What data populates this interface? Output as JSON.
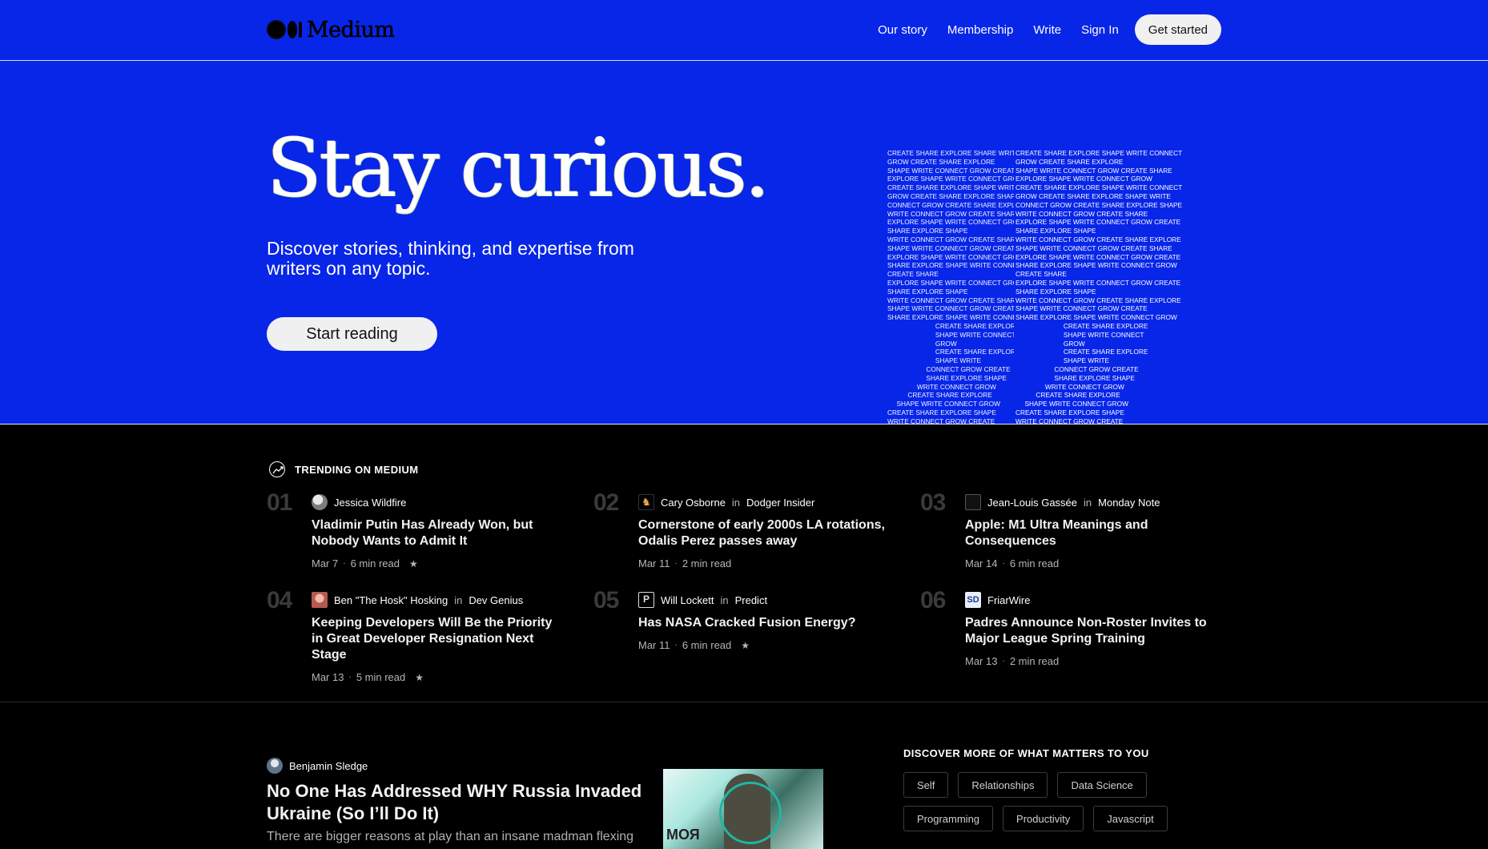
{
  "header": {
    "logo_text": "Medium",
    "nav": [
      "Our story",
      "Membership",
      "Write",
      "Sign In"
    ],
    "cta": "Get started"
  },
  "hero": {
    "title": "Stay curious.",
    "subtitle": "Discover stories, thinking, and expertise from writers on any topic.",
    "button": "Start reading",
    "wordart_left": [
      "CREATE SHARE EXPLORE SHARE WRITE",
      "GROW CREATE SHARE EXPLORE",
      "SHAPE WRITE CONNECT GROW CREATE",
      "EXPLORE SHAPE WRITE CONNECT GROW",
      "CREATE SHARE EXPLORE SHAPE WRITE",
      "GROW CREATE SHARE EXPLORE SHAPE",
      "CONNECT GROW CREATE SHARE EXPLORE",
      "WRITE CONNECT GROW CREATE SHARE",
      "EXPLORE SHAPE WRITE CONNECT GROW",
      "SHARE EXPLORE SHAPE",
      "WRITE CONNECT GROW CREATE SHARE",
      "SHAPE WRITE CONNECT GROW CREATE",
      "EXPLORE SHAPE WRITE CONNECT GROW",
      "SHARE EXPLORE SHAPE WRITE CONNECT",
      "CREATE SHARE",
      "EXPLORE SHAPE WRITE CONNECT GROW",
      "SHARE EXPLORE SHAPE",
      "WRITE CONNECT GROW CREATE SHARE",
      "SHAPE WRITE CONNECT GROW CREATE",
      "SHARE EXPLORE SHAPE WRITE CONNECT",
      "                          CREATE SHARE EXPLORE",
      "                          SHAPE WRITE CONNECT",
      "                          GROW",
      "                          CREATE SHARE EXPLORE",
      "                          SHAPE WRITE",
      "                     CONNECT GROW CREATE",
      "                     SHARE EXPLORE SHAPE",
      "                WRITE CONNECT GROW",
      "           CREATE SHARE EXPLORE",
      "     SHAPE WRITE CONNECT GROW",
      "CREATE SHARE EXPLORE SHAPE",
      "WRITE CONNECT GROW CREATE"
    ],
    "wordart_right": [
      "CREATE SHARE EXPLORE SHAPE WRITE CONNECT",
      "GROW CREATE SHARE EXPLORE",
      "SHAPE WRITE CONNECT GROW CREATE SHARE",
      "EXPLORE SHAPE WRITE CONNECT GROW",
      "CREATE SHARE EXPLORE SHAPE WRITE CONNECT",
      "GROW CREATE SHARE EXPLORE SHAPE WRITE",
      "CONNECT GROW CREATE SHARE EXPLORE SHAPE",
      "WRITE CONNECT GROW CREATE SHARE",
      "EXPLORE SHAPE WRITE CONNECT GROW CREATE",
      "SHARE EXPLORE SHAPE",
      "WRITE CONNECT GROW CREATE SHARE EXPLORE",
      "SHAPE WRITE CONNECT GROW CREATE SHARE",
      "EXPLORE SHAPE WRITE CONNECT GROW CREATE",
      "SHARE EXPLORE SHAPE WRITE CONNECT GROW",
      "CREATE SHARE",
      "EXPLORE SHAPE WRITE CONNECT GROW CREATE",
      "SHARE EXPLORE SHAPE",
      "WRITE CONNECT GROW CREATE SHARE EXPLORE",
      "SHAPE WRITE CONNECT GROW CREATE",
      "SHARE EXPLORE SHAPE WRITE CONNECT GROW",
      "                          CREATE SHARE EXPLORE",
      "                          SHAPE WRITE CONNECT",
      "                          GROW",
      "                          CREATE SHARE EXPLORE",
      "                          SHAPE WRITE",
      "                     CONNECT GROW CREATE",
      "                     SHARE EXPLORE SHAPE",
      "                WRITE CONNECT GROW",
      "           CREATE SHARE EXPLORE",
      "     SHAPE WRITE CONNECT GROW",
      "CREATE SHARE EXPLORE SHAPE",
      "WRITE CONNECT GROW CREATE"
    ]
  },
  "trending": {
    "label": "TRENDING ON MEDIUM",
    "items": [
      {
        "num": "01",
        "author": "Jessica Wildfire",
        "in": "",
        "publication": "",
        "title": "Vladimir Putin Has Already Won, but Nobody Wants to Admit It",
        "date": "Mar 7",
        "read": "6 min read",
        "star": "★"
      },
      {
        "num": "02",
        "author": "Cary Osborne",
        "in": "in",
        "publication": "Dodger Insider",
        "title": "Cornerstone of early 2000s LA rotations, Odalis Perez passes away",
        "date": "Mar 11",
        "read": "2 min read",
        "star": ""
      },
      {
        "num": "03",
        "author": "Jean-Louis Gassée",
        "in": "in",
        "publication": "Monday Note",
        "title": "Apple: M1 Ultra Meanings and Consequences",
        "date": "Mar 14",
        "read": "6 min read",
        "star": ""
      },
      {
        "num": "04",
        "author": "Ben \"The Hosk\" Hosking",
        "in": "in",
        "publication": "Dev Genius",
        "title": "Keeping Developers Will Be the Priority in Great Developer Resignation Next Stage",
        "date": "Mar 13",
        "read": "5 min read",
        "star": "★"
      },
      {
        "num": "05",
        "author": "Will Lockett",
        "in": "in",
        "publication": "Predict",
        "title": "Has NASA Cracked Fusion Energy?",
        "date": "Mar 11",
        "read": "6 min read",
        "star": "★"
      },
      {
        "num": "06",
        "author": "FriarWire",
        "in": "",
        "publication": "",
        "title": "Padres Announce Non-Roster Invites to Major League Spring Training",
        "date": "Mar 13",
        "read": "2 min read",
        "star": ""
      }
    ]
  },
  "feed": {
    "post": {
      "author": "Benjamin Sledge",
      "title": "No One Has Addressed WHY Russia Invaded Ukraine (So I’ll Do It)",
      "excerpt": "There are bigger reasons at play than an insane madman flexing",
      "thumb_text": "МОЯ"
    },
    "discover": {
      "heading": "DISCOVER MORE OF WHAT MATTERS TO YOU",
      "tags": [
        "Self",
        "Relationships",
        "Data Science",
        "Programming",
        "Productivity",
        "Javascript"
      ]
    }
  },
  "colors": {
    "brand_blue": "#0826e8",
    "background": "#000000",
    "muted_text": "#b5b5b5"
  }
}
